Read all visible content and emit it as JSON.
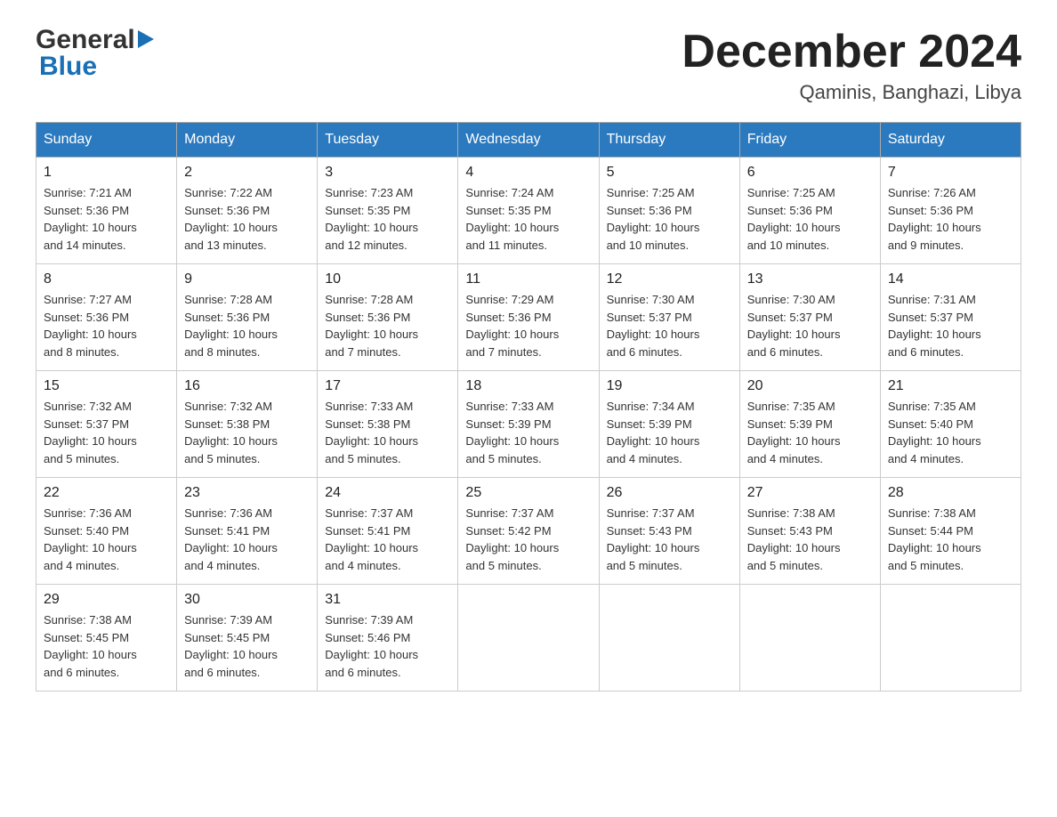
{
  "header": {
    "logo_general": "General",
    "logo_blue": "Blue",
    "month_title": "December 2024",
    "location": "Qaminis, Banghazi, Libya"
  },
  "days_of_week": [
    "Sunday",
    "Monday",
    "Tuesday",
    "Wednesday",
    "Thursday",
    "Friday",
    "Saturday"
  ],
  "weeks": [
    [
      {
        "day": "1",
        "sunrise": "7:21 AM",
        "sunset": "5:36 PM",
        "daylight": "10 hours and 14 minutes."
      },
      {
        "day": "2",
        "sunrise": "7:22 AM",
        "sunset": "5:36 PM",
        "daylight": "10 hours and 13 minutes."
      },
      {
        "day": "3",
        "sunrise": "7:23 AM",
        "sunset": "5:35 PM",
        "daylight": "10 hours and 12 minutes."
      },
      {
        "day": "4",
        "sunrise": "7:24 AM",
        "sunset": "5:35 PM",
        "daylight": "10 hours and 11 minutes."
      },
      {
        "day": "5",
        "sunrise": "7:25 AM",
        "sunset": "5:36 PM",
        "daylight": "10 hours and 10 minutes."
      },
      {
        "day": "6",
        "sunrise": "7:25 AM",
        "sunset": "5:36 PM",
        "daylight": "10 hours and 10 minutes."
      },
      {
        "day": "7",
        "sunrise": "7:26 AM",
        "sunset": "5:36 PM",
        "daylight": "10 hours and 9 minutes."
      }
    ],
    [
      {
        "day": "8",
        "sunrise": "7:27 AM",
        "sunset": "5:36 PM",
        "daylight": "10 hours and 8 minutes."
      },
      {
        "day": "9",
        "sunrise": "7:28 AM",
        "sunset": "5:36 PM",
        "daylight": "10 hours and 8 minutes."
      },
      {
        "day": "10",
        "sunrise": "7:28 AM",
        "sunset": "5:36 PM",
        "daylight": "10 hours and 7 minutes."
      },
      {
        "day": "11",
        "sunrise": "7:29 AM",
        "sunset": "5:36 PM",
        "daylight": "10 hours and 7 minutes."
      },
      {
        "day": "12",
        "sunrise": "7:30 AM",
        "sunset": "5:37 PM",
        "daylight": "10 hours and 6 minutes."
      },
      {
        "day": "13",
        "sunrise": "7:30 AM",
        "sunset": "5:37 PM",
        "daylight": "10 hours and 6 minutes."
      },
      {
        "day": "14",
        "sunrise": "7:31 AM",
        "sunset": "5:37 PM",
        "daylight": "10 hours and 6 minutes."
      }
    ],
    [
      {
        "day": "15",
        "sunrise": "7:32 AM",
        "sunset": "5:37 PM",
        "daylight": "10 hours and 5 minutes."
      },
      {
        "day": "16",
        "sunrise": "7:32 AM",
        "sunset": "5:38 PM",
        "daylight": "10 hours and 5 minutes."
      },
      {
        "day": "17",
        "sunrise": "7:33 AM",
        "sunset": "5:38 PM",
        "daylight": "10 hours and 5 minutes."
      },
      {
        "day": "18",
        "sunrise": "7:33 AM",
        "sunset": "5:39 PM",
        "daylight": "10 hours and 5 minutes."
      },
      {
        "day": "19",
        "sunrise": "7:34 AM",
        "sunset": "5:39 PM",
        "daylight": "10 hours and 4 minutes."
      },
      {
        "day": "20",
        "sunrise": "7:35 AM",
        "sunset": "5:39 PM",
        "daylight": "10 hours and 4 minutes."
      },
      {
        "day": "21",
        "sunrise": "7:35 AM",
        "sunset": "5:40 PM",
        "daylight": "10 hours and 4 minutes."
      }
    ],
    [
      {
        "day": "22",
        "sunrise": "7:36 AM",
        "sunset": "5:40 PM",
        "daylight": "10 hours and 4 minutes."
      },
      {
        "day": "23",
        "sunrise": "7:36 AM",
        "sunset": "5:41 PM",
        "daylight": "10 hours and 4 minutes."
      },
      {
        "day": "24",
        "sunrise": "7:37 AM",
        "sunset": "5:41 PM",
        "daylight": "10 hours and 4 minutes."
      },
      {
        "day": "25",
        "sunrise": "7:37 AM",
        "sunset": "5:42 PM",
        "daylight": "10 hours and 5 minutes."
      },
      {
        "day": "26",
        "sunrise": "7:37 AM",
        "sunset": "5:43 PM",
        "daylight": "10 hours and 5 minutes."
      },
      {
        "day": "27",
        "sunrise": "7:38 AM",
        "sunset": "5:43 PM",
        "daylight": "10 hours and 5 minutes."
      },
      {
        "day": "28",
        "sunrise": "7:38 AM",
        "sunset": "5:44 PM",
        "daylight": "10 hours and 5 minutes."
      }
    ],
    [
      {
        "day": "29",
        "sunrise": "7:38 AM",
        "sunset": "5:45 PM",
        "daylight": "10 hours and 6 minutes."
      },
      {
        "day": "30",
        "sunrise": "7:39 AM",
        "sunset": "5:45 PM",
        "daylight": "10 hours and 6 minutes."
      },
      {
        "day": "31",
        "sunrise": "7:39 AM",
        "sunset": "5:46 PM",
        "daylight": "10 hours and 6 minutes."
      },
      null,
      null,
      null,
      null
    ]
  ],
  "labels": {
    "sunrise": "Sunrise:",
    "sunset": "Sunset:",
    "daylight": "Daylight:"
  }
}
